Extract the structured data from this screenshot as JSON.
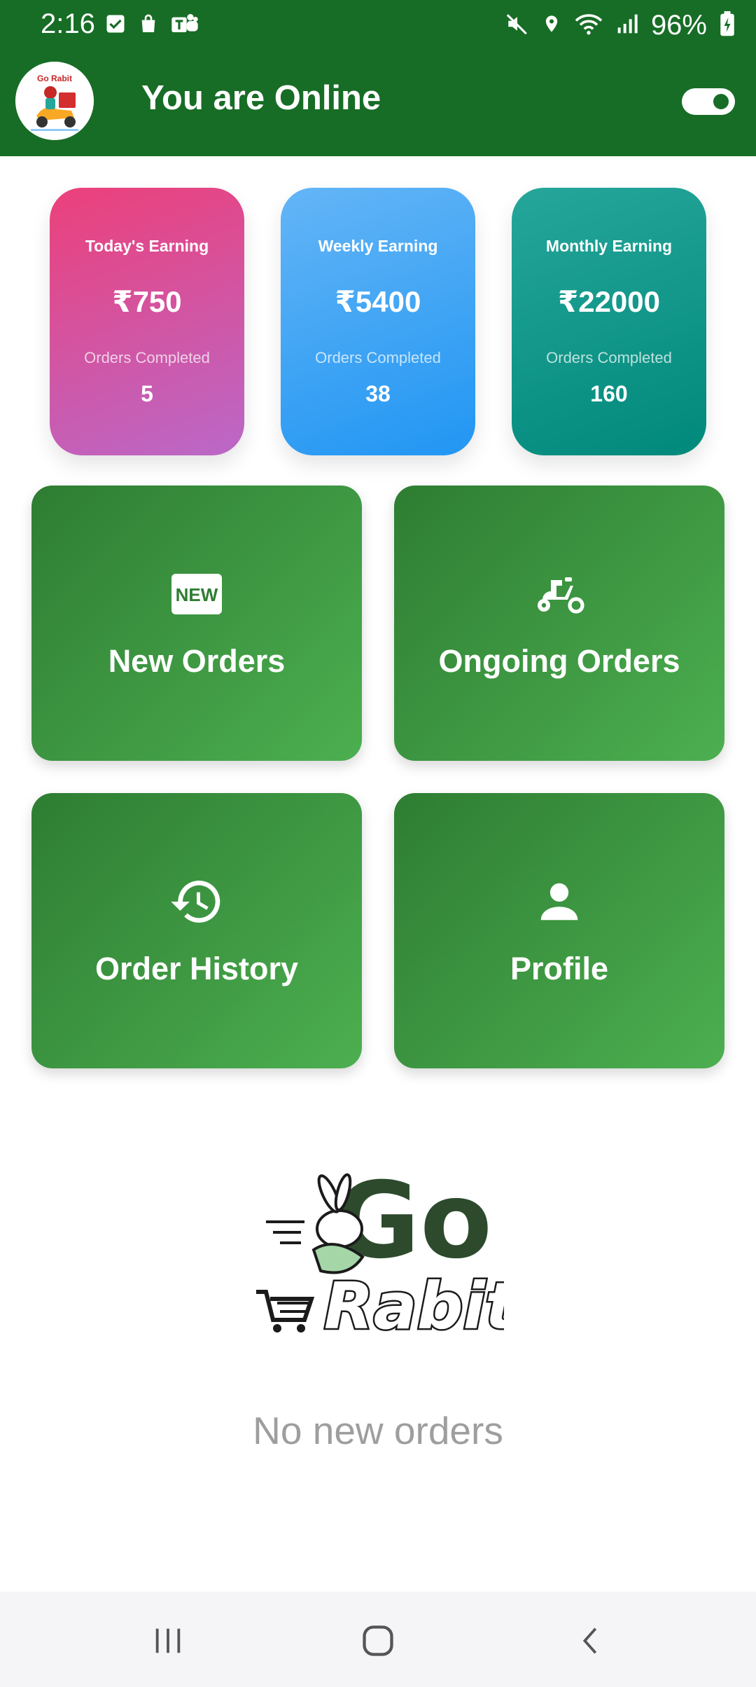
{
  "status_bar": {
    "time": "2:16",
    "battery": "96%"
  },
  "header": {
    "logo_text": "Go Rabit",
    "title": "You are Online",
    "online_toggle": true,
    "bg_color": "#176d26"
  },
  "earnings": [
    {
      "label": "Today's Earning",
      "amount": "₹750",
      "orders_label": "Orders Completed",
      "orders": "5"
    },
    {
      "label": "Weekly Earning",
      "amount": "₹5400",
      "orders_label": "Orders Completed",
      "orders": "38"
    },
    {
      "label": "Monthly Earning",
      "amount": "₹22000",
      "orders_label": "Orders Completed",
      "orders": "160"
    }
  ],
  "tiles": [
    {
      "label": "New Orders",
      "icon": "new-badge-icon"
    },
    {
      "label": "Ongoing Orders",
      "icon": "scooter-icon"
    },
    {
      "label": "Order History",
      "icon": "history-icon"
    },
    {
      "label": "Profile",
      "icon": "person-icon"
    }
  ],
  "brand": {
    "logo_go": "Go",
    "logo_rabit": "Rabit"
  },
  "empty_message": "No new orders",
  "nav": {
    "icons": [
      "recent-apps-icon",
      "home-icon",
      "back-icon"
    ]
  }
}
